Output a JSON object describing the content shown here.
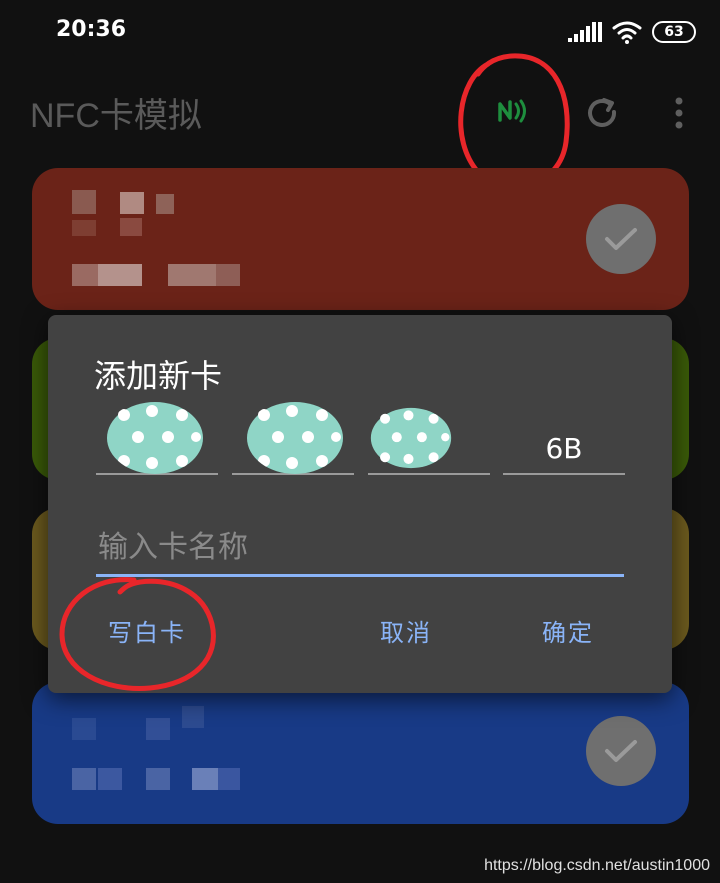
{
  "status_bar": {
    "time": "20:36",
    "battery": "63",
    "icons": [
      "signal-icon",
      "wifi-icon",
      "battery-icon"
    ]
  },
  "app_bar": {
    "title": "NFC卡模拟",
    "actions": [
      "nfc-icon",
      "refresh-icon",
      "more-vert-icon"
    ]
  },
  "colors": {
    "nfc_icon": "#1e8e3e",
    "annotation": "#e8262a",
    "card_red": "#6b2318",
    "card_green": "#3a5a08",
    "card_gold": "#6c5a1e",
    "card_blue": "#183a86",
    "dialog_bg": "#424242",
    "accent": "#8ab4f8",
    "blob": "#8fd5c6"
  },
  "cards": [
    {
      "color": "red",
      "selected": true
    },
    {
      "color": "green",
      "selected": false
    },
    {
      "color": "gold",
      "selected": false
    },
    {
      "color": "blue",
      "selected": true
    }
  ],
  "dialog": {
    "title": "添加新卡",
    "uid_fields": [
      {
        "value": "",
        "redacted": true
      },
      {
        "value": "",
        "redacted": true
      },
      {
        "value": "",
        "redacted": true
      },
      {
        "value": "6B",
        "redacted": false
      }
    ],
    "name_input": {
      "value": "",
      "placeholder": "输入卡名称"
    },
    "buttons": {
      "write_blank": "写白卡",
      "cancel": "取消",
      "confirm": "确定"
    }
  },
  "watermark": "https://blog.csdn.net/austin1000"
}
